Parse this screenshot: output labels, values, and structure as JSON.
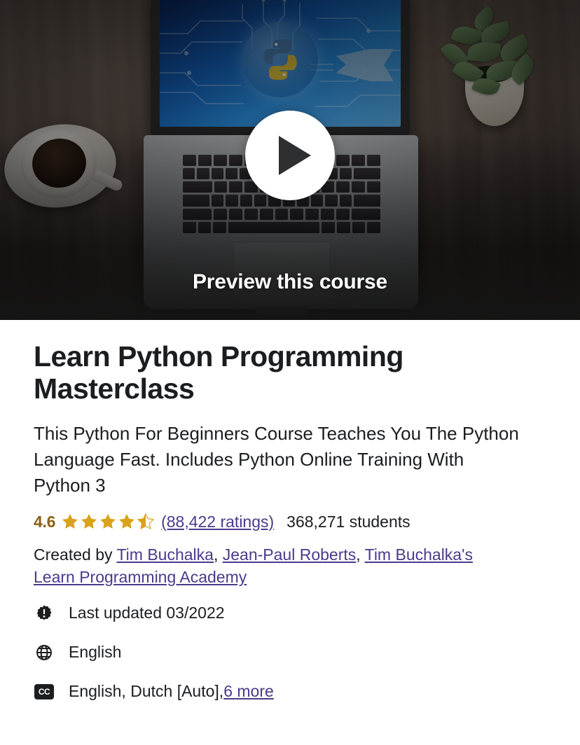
{
  "hero": {
    "preview_label": "Preview this course",
    "play_icon": "play-icon",
    "thumbnail_description": "Laptop on wooden desk showing Python logo with circuit traces, coffee cup at left, potted plant at right"
  },
  "course": {
    "title": "Learn Python Programming Masterclass",
    "headline": "This Python For Beginners Course Teaches You The Python Language Fast. Includes Python Online Training With Python 3",
    "rating": {
      "value": "4.6",
      "stars_filled": 4,
      "stars_half": 1,
      "stars_total": 5,
      "ratings_link": "(88,422 ratings)",
      "students": "368,271 students"
    },
    "created_by": {
      "prefix": "Created by ",
      "instructors": [
        "Tim Buchalka",
        "Jean-Paul Roberts",
        "Tim Buchalka's Learn Programming Academy"
      ],
      "separator": ", "
    },
    "meta": [
      {
        "icon": "update-badge-icon",
        "text": "Last updated 03/2022",
        "link": null
      },
      {
        "icon": "globe-icon",
        "text": "English",
        "link": null
      },
      {
        "icon": "closed-caption-icon",
        "text": "English, Dutch [Auto], ",
        "link": "6 more"
      }
    ]
  },
  "colors": {
    "link": "#4b3a8c",
    "rating_gold": "#8a6116",
    "star_gold": "#d9a21b",
    "text": "#1c1d1f",
    "page_background": "#ffffff"
  }
}
